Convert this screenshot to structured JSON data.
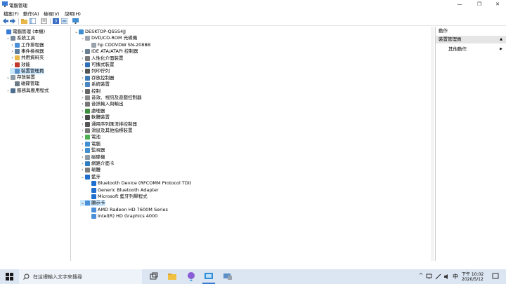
{
  "window": {
    "title": "電腦管理"
  },
  "menu": [
    "檔案(F)",
    "動作(A)",
    "檢視(V)",
    "說明(H)"
  ],
  "left_tree": [
    {
      "label": "電腦管理 (本機)",
      "icon": "computer-management-icon",
      "exp": "",
      "level": 0
    },
    {
      "label": "系統工具",
      "icon": "system-tools-icon",
      "exp": "v",
      "level": 1
    },
    {
      "label": "工作排程器",
      "icon": "task-scheduler-icon",
      "exp": ">",
      "level": 2
    },
    {
      "label": "事件檢視器",
      "icon": "event-viewer-icon",
      "exp": ">",
      "level": 2
    },
    {
      "label": "共用資料夾",
      "icon": "shared-folders-icon",
      "exp": ">",
      "level": 2
    },
    {
      "label": "效能",
      "icon": "performance-icon",
      "exp": ">",
      "level": 2
    },
    {
      "label": "裝置管理員",
      "icon": "device-manager-icon",
      "exp": "",
      "level": 2,
      "selected": true
    },
    {
      "label": "存放裝置",
      "icon": "storage-icon",
      "exp": "v",
      "level": 1
    },
    {
      "label": "磁碟管理",
      "icon": "disk-management-icon",
      "exp": "",
      "level": 2
    },
    {
      "label": "服務與應用程式",
      "icon": "services-icon",
      "exp": ">",
      "level": 1
    }
  ],
  "device_tree": [
    {
      "label": "DESKTOP-QS5S4JJ",
      "icon": "computer-icon",
      "exp": "v",
      "level": 0
    },
    {
      "label": "DVD/CD-ROM 光碟機",
      "icon": "dvd-drive-icon",
      "exp": "v",
      "level": 1
    },
    {
      "label": "hp CDDVDW SN-208BB",
      "icon": "dvd-drive-icon",
      "exp": "",
      "level": 2
    },
    {
      "label": "IDE ATA/ATAPI 控制器",
      "icon": "ide-controller-icon",
      "exp": ">",
      "level": 1
    },
    {
      "label": "人性化介面裝置",
      "icon": "hid-icon",
      "exp": ">",
      "level": 1
    },
    {
      "label": "可攜式裝置",
      "icon": "portable-device-icon",
      "exp": ">",
      "level": 1
    },
    {
      "label": "列印佇列",
      "icon": "print-queue-icon",
      "exp": ">",
      "level": 1
    },
    {
      "label": "存放控制器",
      "icon": "storage-controller-icon",
      "exp": ">",
      "level": 1
    },
    {
      "label": "系統裝置",
      "icon": "system-device-icon",
      "exp": ">",
      "level": 1
    },
    {
      "label": "控制",
      "icon": "mouse-icon",
      "exp": ">",
      "level": 1
    },
    {
      "label": "音效、視訊及遊戲控制器",
      "icon": "sound-icon",
      "exp": ">",
      "level": 1
    },
    {
      "label": "音訊輸入與輸出",
      "icon": "audio-io-icon",
      "exp": ">",
      "level": 1
    },
    {
      "label": "處理器",
      "icon": "processor-icon",
      "exp": ">",
      "level": 1
    },
    {
      "label": "軟體裝置",
      "icon": "software-device-icon",
      "exp": ">",
      "level": 1
    },
    {
      "label": "通用序列匯流排控制器",
      "icon": "usb-icon",
      "exp": ">",
      "level": 1
    },
    {
      "label": "滑鼠及其他指標裝置",
      "icon": "pointing-device-icon",
      "exp": ">",
      "level": 1
    },
    {
      "label": "電池",
      "icon": "battery-icon",
      "exp": ">",
      "level": 1
    },
    {
      "label": "電腦",
      "icon": "computer-icon",
      "exp": ">",
      "level": 1
    },
    {
      "label": "監視器",
      "icon": "monitor-icon",
      "exp": ">",
      "level": 1
    },
    {
      "label": "磁碟機",
      "icon": "disk-drive-icon",
      "exp": ">",
      "level": 1
    },
    {
      "label": "網路介面卡",
      "icon": "network-adapter-icon",
      "exp": ">",
      "level": 1
    },
    {
      "label": "韌體",
      "icon": "firmware-icon",
      "exp": ">",
      "level": 1
    },
    {
      "label": "藍牙",
      "icon": "bluetooth-icon",
      "exp": "v",
      "level": 1
    },
    {
      "label": "Bluetooth Device (RFCOMM Protocol TDI)",
      "icon": "bluetooth-icon",
      "exp": "",
      "level": 2
    },
    {
      "label": "Generic Bluetooth Adapter",
      "icon": "bluetooth-icon",
      "exp": "",
      "level": 2
    },
    {
      "label": "Microsoft 藍牙列舉程式",
      "icon": "bluetooth-icon",
      "exp": "",
      "level": 2
    },
    {
      "label": "顯示卡",
      "icon": "display-adapter-icon",
      "exp": "v",
      "level": 1,
      "selected": true
    },
    {
      "label": "AMD Radeon HD 7600M Series",
      "icon": "display-adapter-icon",
      "exp": "",
      "level": 2
    },
    {
      "label": "Intel(R) HD Graphics 4000",
      "icon": "display-adapter-icon",
      "exp": "",
      "level": 2
    }
  ],
  "actions": {
    "header": "動作",
    "section": "裝置管理員",
    "more": "其他動作"
  },
  "taskbar": {
    "search_placeholder": "在這裡輸入文字來搜尋",
    "time": "下午 10:02",
    "date": "2020/5/12",
    "ime": "中"
  },
  "colors": {
    "selection": "#cce8ff",
    "action_header": "#e5e5e5",
    "taskbar": "#dce6f2"
  }
}
